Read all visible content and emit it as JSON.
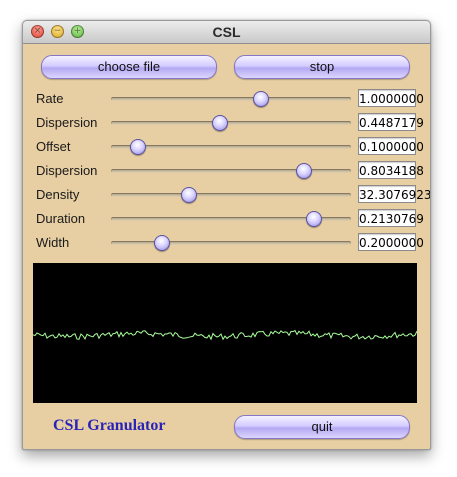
{
  "window": {
    "title": "CSL"
  },
  "buttons": {
    "choose_file": "choose file",
    "stop": "stop",
    "quit": "quit"
  },
  "sliders": [
    {
      "label": "Rate",
      "value": "1.0000000",
      "position": 0.62
    },
    {
      "label": "Dispersion",
      "value": "0.4487179",
      "position": 0.45
    },
    {
      "label": "Offset",
      "value": "0.1000000",
      "position": 0.11
    },
    {
      "label": "Dispersion",
      "value": "0.8034188",
      "position": 0.8
    },
    {
      "label": "Density",
      "value": "32.3076923",
      "position": 0.32
    },
    {
      "label": "Duration",
      "value": "0.2130769",
      "position": 0.84
    },
    {
      "label": "Width",
      "value": "0.2000000",
      "position": 0.21
    }
  ],
  "brand": {
    "text": "CSL Granulator"
  },
  "colors": {
    "window_bg": "#e7cfa3",
    "waveform": "#a8ff9a",
    "brand": "#2a23b8"
  }
}
